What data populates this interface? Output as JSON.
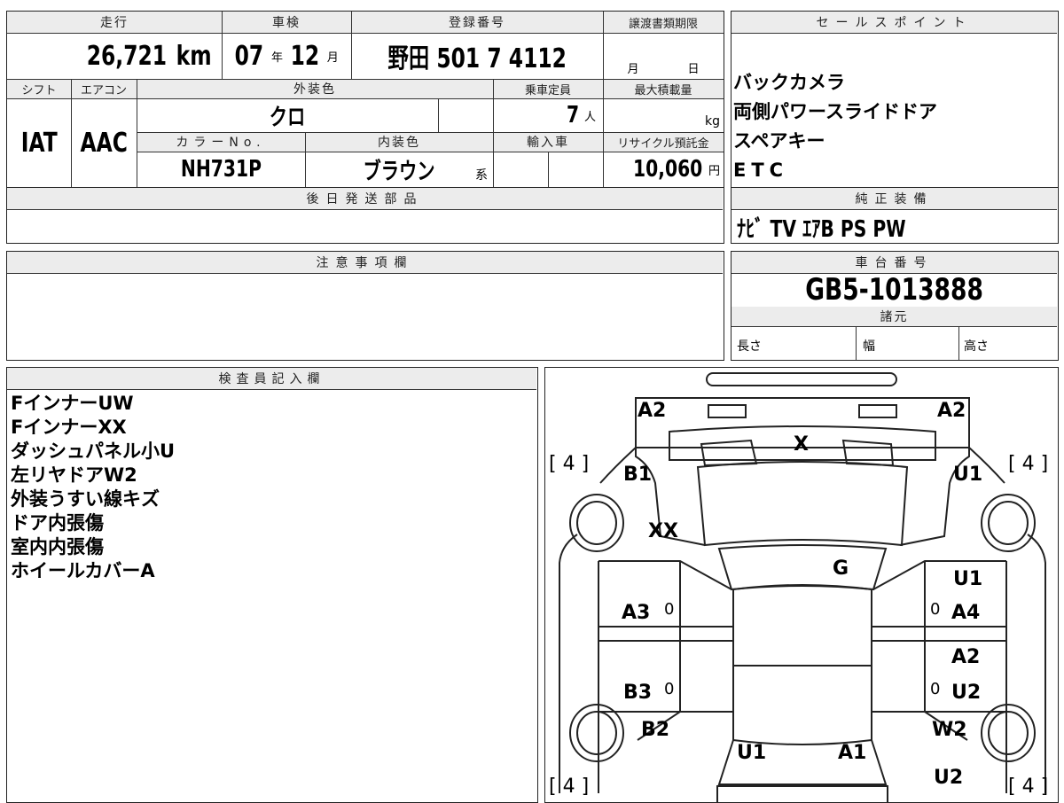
{
  "vehicle": {
    "mileage_label": "走行",
    "mileage_value": "26,721",
    "mileage_unit": "km",
    "inspection_label": "車検",
    "inspection_year": "07",
    "year_unit": "年",
    "inspection_month": "12",
    "month_unit": "月",
    "registration_label": "登録番号",
    "registration_value": "野田 501 7 4112",
    "transfer_label": "譲渡書類期限",
    "transfer_month": "月",
    "transfer_day": "日",
    "shift_label": "シフト",
    "shift_value": "IAT",
    "ac_label": "エアコン",
    "ac_value": "AAC",
    "exterior_label": "外装色",
    "exterior_value": "クロ",
    "capacity_label": "乗車定員",
    "capacity_value": "7",
    "capacity_unit": "人",
    "maxload_label": "最大積載量",
    "maxload_unit": "kg",
    "color_no_label": "カラーNo.",
    "color_no_value": "NH731P",
    "interior_label": "内装色",
    "interior_value": "ブラウン",
    "interior_suffix": "系",
    "import_label": "輸入車",
    "recycle_label": "リサイクル預託金",
    "recycle_value": "10,060",
    "recycle_unit": "円",
    "later_parts_label": "後日発送部品"
  },
  "sales": {
    "title": "セールスポイント",
    "items": [
      "バックカメラ",
      "両側パワースライドドア",
      "スペアキー",
      "ETC"
    ]
  },
  "equipment": {
    "title": "純正装備",
    "value": "ﾅﾋﾞ TV ｴｱB PS PW"
  },
  "notes": {
    "title": "注意事項欄"
  },
  "chassis": {
    "title": "車台番号",
    "value": "GB5-1013888",
    "spec_title": "諸元",
    "length": "長さ",
    "width": "幅",
    "height": "高さ"
  },
  "inspector": {
    "title": "検査員記入欄",
    "items": [
      "FインナーUW",
      "FインナーXX",
      "ダッシュパネル小U",
      "左リヤドアW2",
      "外装うすい線キズ",
      "ドア内張傷",
      "室内内張傷",
      "ホイールカバーA"
    ]
  },
  "diagram": {
    "tire_tl": "[ 4 ]",
    "tire_tr": "[ 4 ]",
    "tire_bl": "[ 4 ]",
    "tire_br": "[ 4 ]",
    "marks": {
      "a2_left": "A2",
      "a2_right": "A2",
      "x": "X",
      "b1": "B1",
      "u1_top_right": "U1",
      "xx": "XX",
      "g": "G",
      "u1_mid_right": "U1",
      "a3": "A3",
      "a4": "A4",
      "a2_mid_right": "A2",
      "b3": "B3",
      "u2_mid_right": "U2",
      "b2": "B2",
      "w2": "W2",
      "u1_bottom": "U1",
      "a1_bottom": "A1",
      "u2_bottom": "U2",
      "zero_a3": "0",
      "zero_a4": "0",
      "zero_b3": "0",
      "zero_u2": "0"
    }
  }
}
